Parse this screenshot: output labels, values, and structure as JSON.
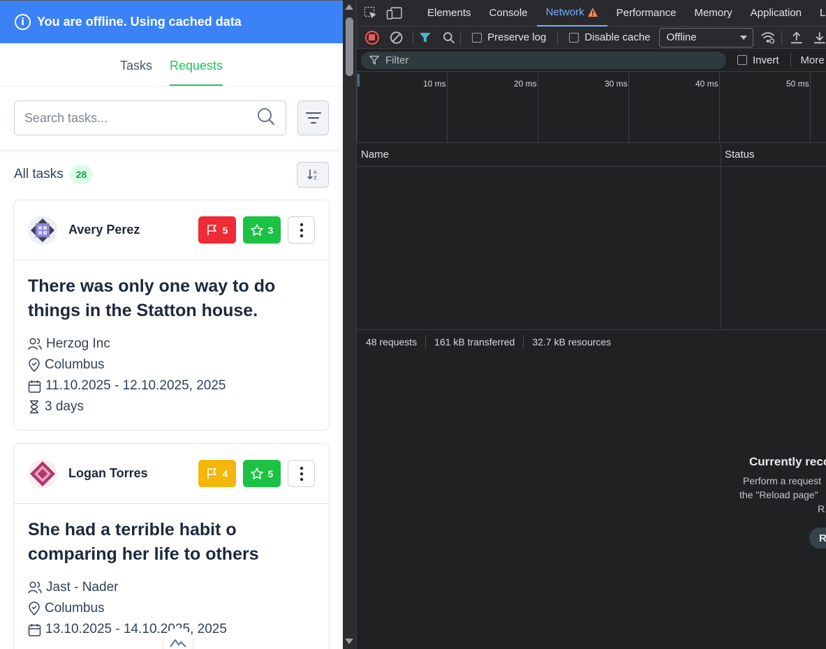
{
  "banner": {
    "text": "You are offline. Using cached data",
    "icon": "info-icon"
  },
  "tabs": [
    {
      "label": "Tasks",
      "active": false
    },
    {
      "label": "Requests",
      "active": true
    }
  ],
  "search": {
    "placeholder": "Search tasks...",
    "value": ""
  },
  "list": {
    "title": "All tasks",
    "count": "28"
  },
  "cards": [
    {
      "name": "Avery Perez",
      "flag_count": "5",
      "flag_color": "#ef2b35",
      "star_count": "3",
      "title": "There was only one way to do things in the Statton house.",
      "company": "Herzog Inc",
      "location": "Columbus",
      "dates": "11.10.2025 - 12.10.2025, 2025",
      "duration": "3 days"
    },
    {
      "name": "Logan Torres",
      "flag_count": "4",
      "flag_color": "#f2b70a",
      "star_count": "5",
      "title": "She had a terrible habit o comparing her life to others",
      "company": "Jast - Nader",
      "location": "Columbus",
      "dates": "13.10.2025 - 14.10.2025, 2025"
    }
  ],
  "devtools": {
    "tabs": [
      "Elements",
      "Console",
      "Network",
      "Performance",
      "Memory",
      "Application",
      "L"
    ],
    "active_tab": "Network",
    "toolbar": {
      "preserve_log": "Preserve log",
      "disable_cache": "Disable cache",
      "throttling": "Offline"
    },
    "filter": {
      "placeholder": "Filter",
      "invert": "Invert",
      "more": "More"
    },
    "timeline_ticks": [
      "10 ms",
      "20 ms",
      "30 ms",
      "40 ms",
      "50 ms"
    ],
    "columns": [
      "Name",
      "Status"
    ],
    "summary": {
      "requests": "48 requests",
      "transferred": "161 kB transferred",
      "resources": "32.7 kB resources"
    },
    "empty": {
      "title": "Currently reco",
      "line1": "Perform a request",
      "line2": "the \"Reload page\"",
      "line3": "R.",
      "button": "R"
    }
  },
  "colors": {
    "banner": "#3b82f6",
    "accent_green": "#22c55e",
    "devtools_accent": "#7cacf8"
  }
}
